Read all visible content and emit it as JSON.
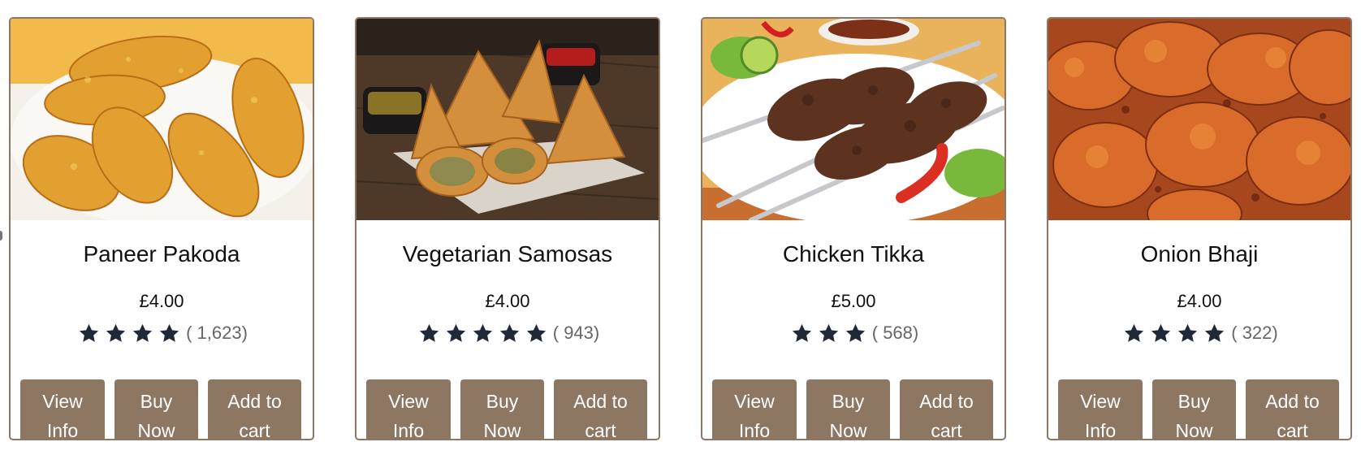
{
  "products": [
    {
      "name": "Paneer Pakoda",
      "price": "£4.00",
      "rating": 4,
      "reviews": "( 1,623)",
      "image_icon": "paneer-pakoda-photo",
      "buttons": {
        "view": "View Info",
        "buy": "Buy Now",
        "cart": "Add to cart"
      }
    },
    {
      "name": "Vegetarian Samosas",
      "price": "£4.00",
      "rating": 5,
      "reviews": "( 943)",
      "image_icon": "vegetarian-samosas-photo",
      "buttons": {
        "view": "View Info",
        "buy": "Buy Now",
        "cart": "Add to cart"
      }
    },
    {
      "name": "Chicken Tikka",
      "price": "£5.00",
      "rating": 3,
      "reviews": "( 568)",
      "image_icon": "chicken-tikka-photo",
      "buttons": {
        "view": "View Info",
        "buy": "Buy Now",
        "cart": "Add to cart"
      }
    },
    {
      "name": "Onion Bhaji",
      "price": "£4.00",
      "rating": 4,
      "reviews": "( 322)",
      "image_icon": "onion-bhaji-photo",
      "buttons": {
        "view": "View Info",
        "buy": "Buy Now",
        "cart": "Add to cart"
      }
    }
  ],
  "colors": {
    "accent": "#8d7762",
    "star": "#1f2937",
    "review_text": "#666666"
  }
}
